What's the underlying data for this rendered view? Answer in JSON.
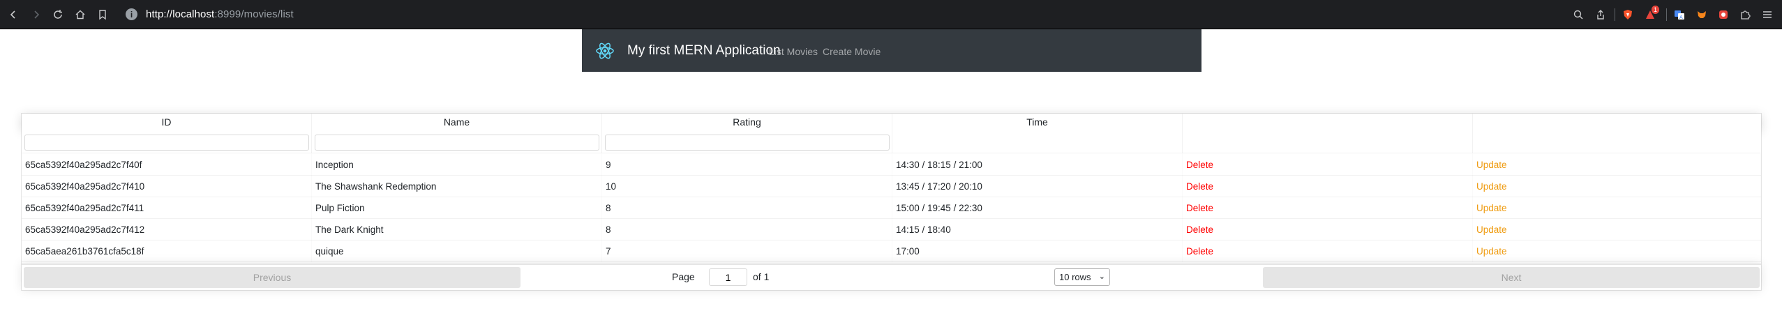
{
  "browser": {
    "url_host": "http://localhost",
    "url_rest": ":8999/movies/list",
    "shield_badge": "1",
    "icons": [
      "back-icon",
      "forward-icon",
      "reload-icon",
      "home-icon",
      "bookmark-icon",
      "info-icon",
      "zoom-icon",
      "share-icon",
      "brave-shield-icon",
      "brave-rewards-icon",
      "translate-icon",
      "metamask-icon",
      "extension-icon",
      "puzzle-icon",
      "menu-icon"
    ]
  },
  "navbar": {
    "brand": "My first MERN Application",
    "links": [
      "List Movies",
      "Create Movie"
    ]
  },
  "table": {
    "headers": [
      "ID",
      "Name",
      "Rating",
      "Time",
      "",
      ""
    ],
    "rows": [
      {
        "id": "65ca5392f40a295ad2c7f40f",
        "name": "Inception",
        "rating": "9",
        "time": "14:30 / 18:15 / 21:00",
        "delete": "Delete",
        "update": "Update"
      },
      {
        "id": "65ca5392f40a295ad2c7f410",
        "name": "The Shawshank Redemption",
        "rating": "10",
        "time": "13:45 / 17:20 / 20:10",
        "delete": "Delete",
        "update": "Update"
      },
      {
        "id": "65ca5392f40a295ad2c7f411",
        "name": "Pulp Fiction",
        "rating": "8",
        "time": "15:00 / 19:45 / 22:30",
        "delete": "Delete",
        "update": "Update"
      },
      {
        "id": "65ca5392f40a295ad2c7f412",
        "name": "The Dark Knight",
        "rating": "8",
        "time": "14:15 / 18:40",
        "delete": "Delete",
        "update": "Update"
      },
      {
        "id": "65ca5aea261b3761cfa5c18f",
        "name": "quique",
        "rating": "7",
        "time": "17:00",
        "delete": "Delete",
        "update": "Update"
      }
    ],
    "pagination": {
      "previous": "Previous",
      "next": "Next",
      "page_label": "Page",
      "page_value": "1",
      "of_label": "of 1",
      "rows_select": "10 rows"
    }
  },
  "colors": {
    "delete": "#ff0000",
    "update": "#ef9b0f",
    "navbar_bg": "#343a40",
    "chrome_bg": "#1e1f22"
  }
}
